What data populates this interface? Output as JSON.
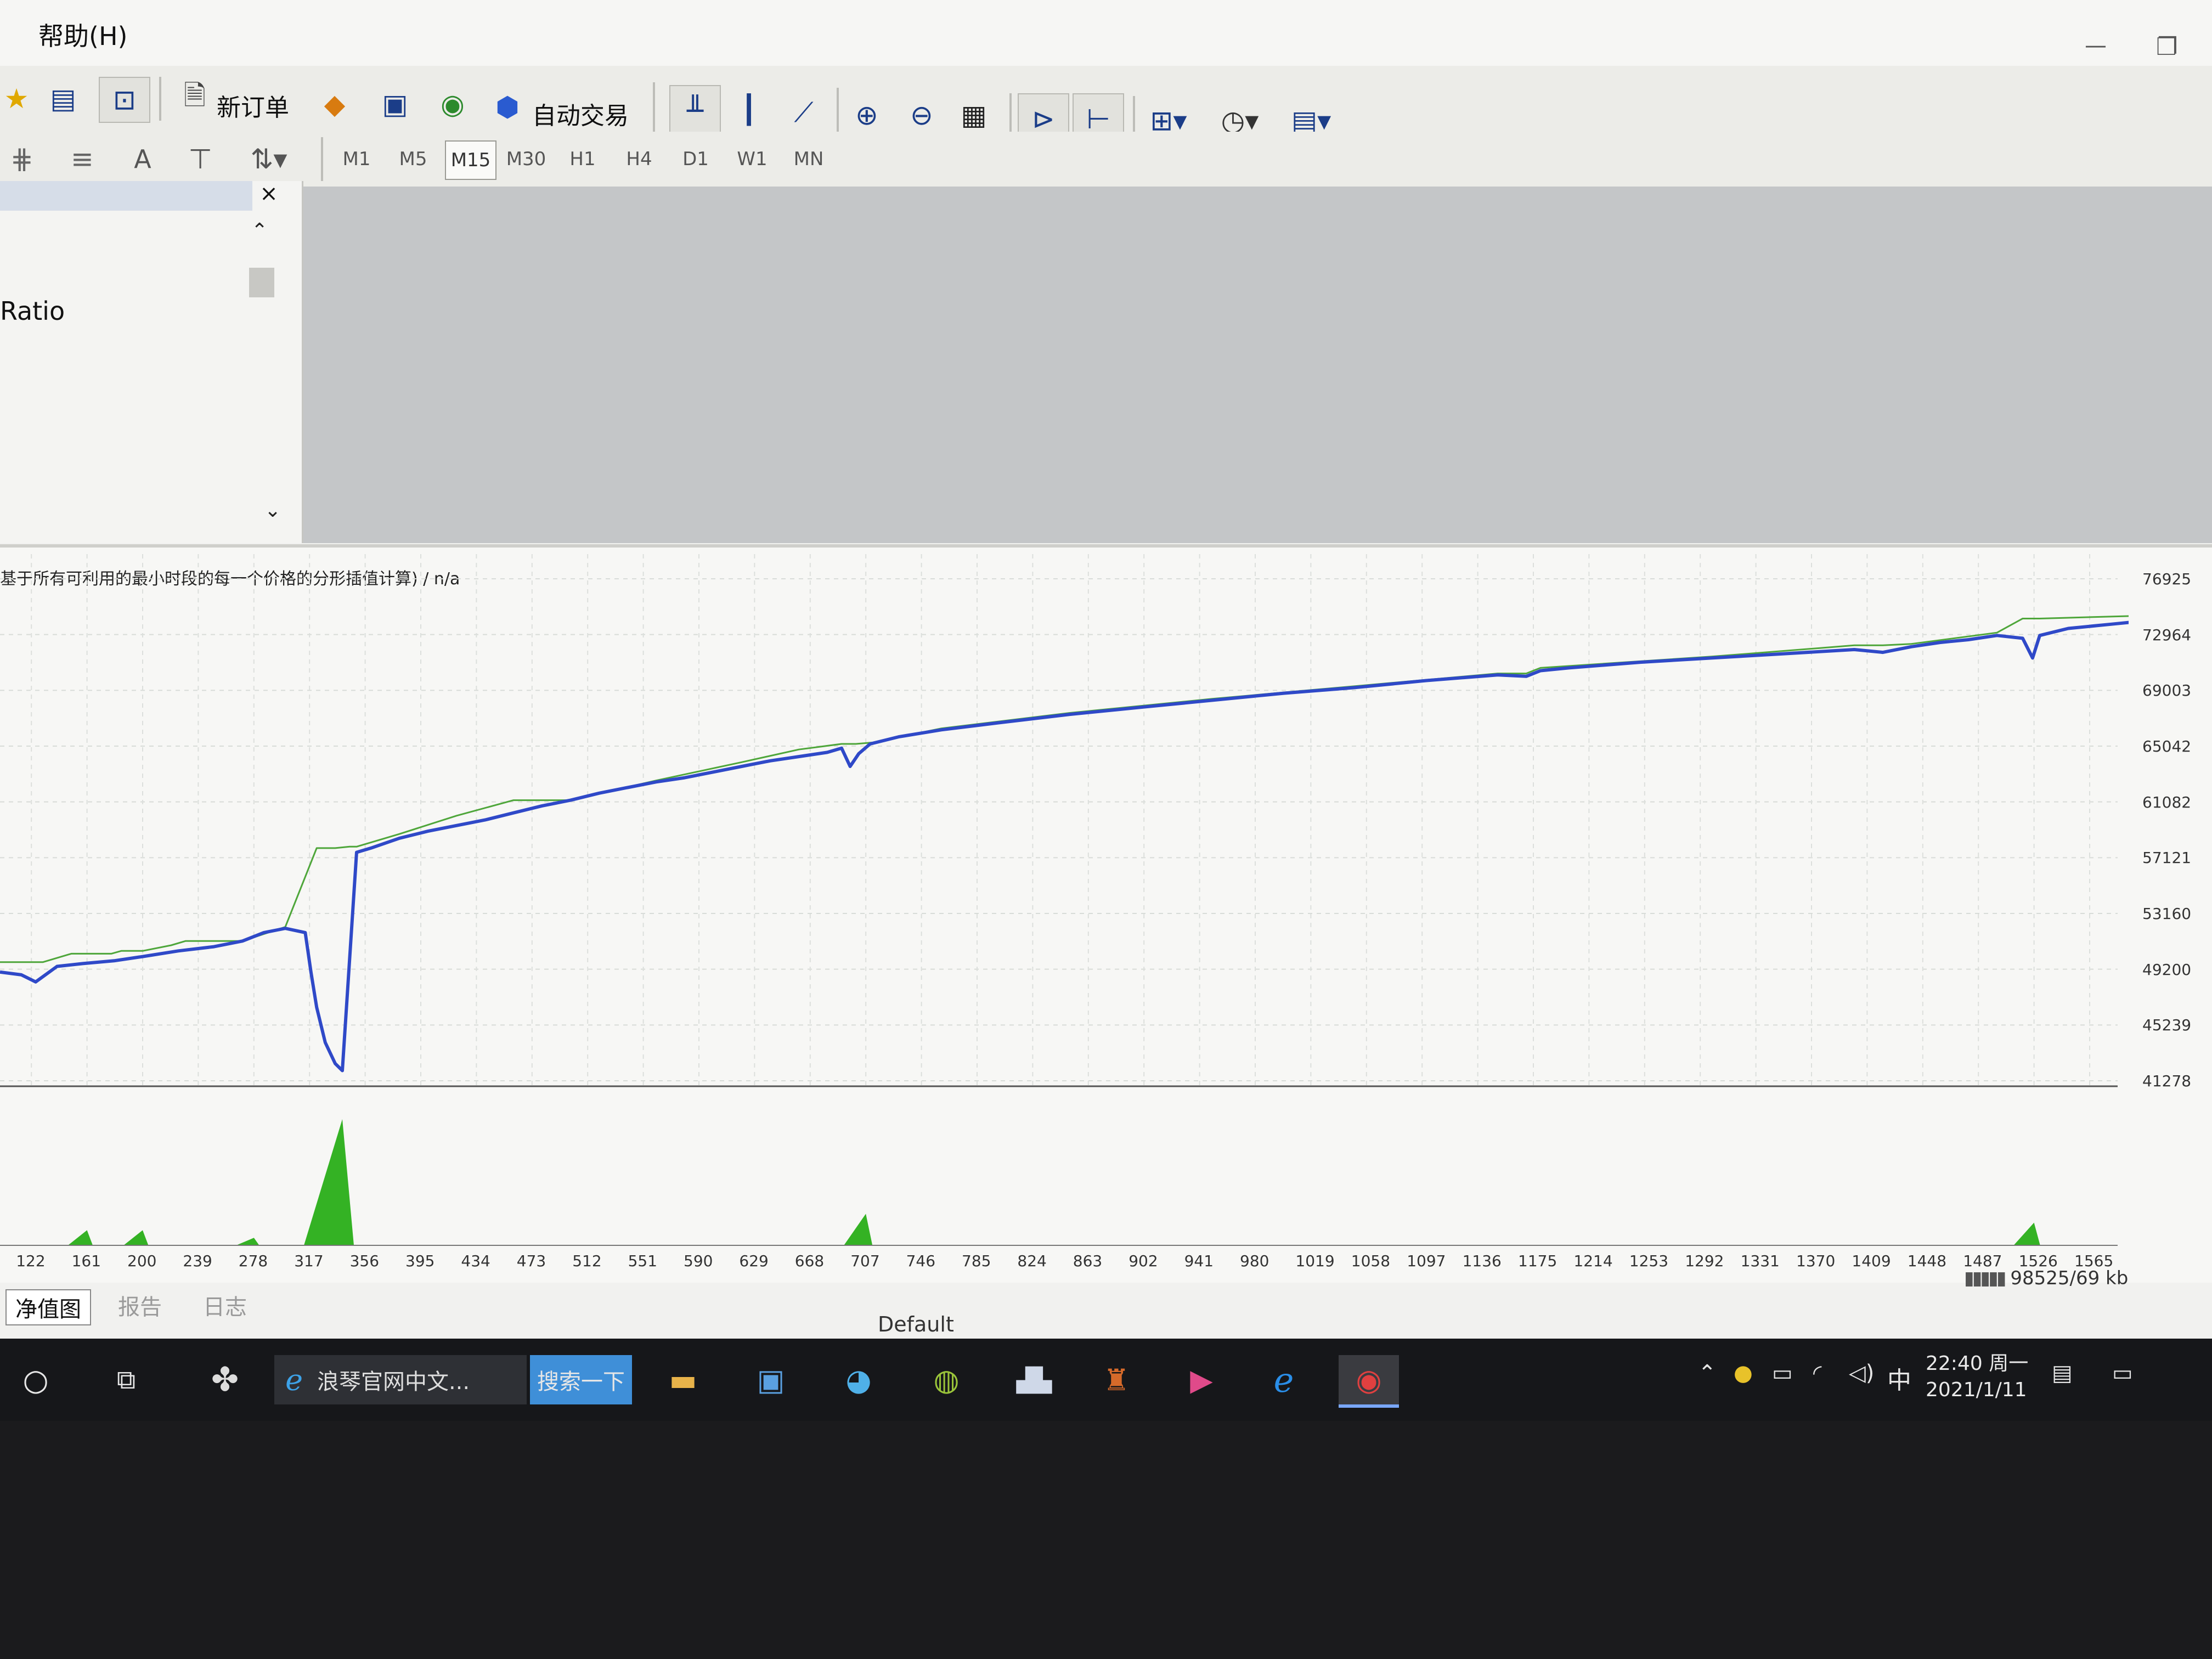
{
  "menu": {
    "help": "帮助(H)"
  },
  "toolbar1": {
    "new_order": "新订单",
    "auto_trading": "自动交易"
  },
  "toolbar2": {
    "text_tool": "A",
    "timeframes": [
      "M1",
      "M5",
      "M15",
      "M30",
      "H1",
      "H4",
      "D1",
      "W1",
      "MN"
    ],
    "active_timeframe": "M15"
  },
  "navigator": {
    "close": "×",
    "visible_text": "Ratio"
  },
  "tester": {
    "graph_title": "基于所有可利用的最小时段的每一个价格的分形插值计算) / n/a",
    "tabs": [
      "净值图",
      "报告",
      "日志"
    ],
    "active_tab": "净值图",
    "profile": "Default",
    "memory": "98525/69 kb"
  },
  "taskbar": {
    "browser_tab": "浪琴官网中文...",
    "search_button": "搜索一下",
    "ime": "中",
    "time": "22:40 周一",
    "date": "2021/1/11"
  },
  "colors": {
    "balance": "#2f49c8",
    "equity": "#4ea63a",
    "volume": "#34b224"
  },
  "chart_data": {
    "type": "line",
    "title": "基于所有可利用的最小时段的每一个价格的分形插值计算) / n/a",
    "xlabel": "",
    "ylabel": "",
    "x_ticks": [
      "122",
      "161",
      "200",
      "239",
      "278",
      "317",
      "356",
      "395",
      "434",
      "473",
      "512",
      "551",
      "590",
      "629",
      "668",
      "707",
      "746",
      "785",
      "824",
      "863",
      "902",
      "941",
      "980",
      "1019",
      "1058",
      "1097",
      "1136",
      "1175",
      "1214",
      "1253",
      "1292",
      "1331",
      "1370",
      "1409",
      "1448",
      "1487",
      "1526",
      "1565"
    ],
    "y_ticks": [
      "76925",
      "72964",
      "69003",
      "65042",
      "61082",
      "57121",
      "53160",
      "49200",
      "45239",
      "41278"
    ],
    "xlim": [
      100,
      1600
    ],
    "ylim": [
      41278,
      76925
    ],
    "grid": true,
    "series": [
      {
        "x": [
          100,
          115,
          125,
          140,
          158,
          180,
          200,
          225,
          250,
          270,
          285,
          300,
          314,
          318,
          322,
          328,
          335,
          340,
          350,
          360,
          380,
          400,
          420,
          440,
          460,
          480,
          500,
          520,
          540,
          560,
          580,
          600,
          620,
          640,
          660,
          680,
          690,
          696,
          702,
          710,
          730,
          760,
          800,
          850,
          900,
          950,
          1000,
          1050,
          1100,
          1150,
          1170,
          1180,
          1200,
          1250,
          1300,
          1350,
          1400,
          1420,
          1440,
          1460,
          1480,
          1500,
          1518,
          1525,
          1530,
          1550,
          1580,
          1600
        ],
        "y": [
          49000,
          48800,
          48300,
          49400,
          49600,
          49800,
          50100,
          50500,
          50800,
          51200,
          51800,
          52100,
          51800,
          49000,
          46500,
          44000,
          42500,
          42000,
          57500,
          57800,
          58500,
          59000,
          59400,
          59800,
          60300,
          60800,
          61200,
          61700,
          62100,
          62500,
          62800,
          63200,
          63600,
          64000,
          64300,
          64600,
          64900,
          63600,
          64500,
          65200,
          65700,
          66200,
          66700,
          67300,
          67800,
          68300,
          68800,
          69200,
          69700,
          70100,
          70000,
          70400,
          70600,
          71000,
          71300,
          71600,
          71900,
          71700,
          72100,
          72400,
          72600,
          72900,
          72700,
          71300,
          72900,
          73400,
          73700,
          73900
        ]
      },
      {
        "x": [
          100,
          125,
          130,
          150,
          160,
          178,
          185,
          200,
          220,
          230,
          250,
          270,
          300,
          322,
          328,
          335,
          345,
          350,
          380,
          420,
          460,
          480,
          500,
          560,
          620,
          660,
          690,
          696,
          700,
          712,
          760,
          850,
          950,
          1050,
          1150,
          1170,
          1180,
          1300,
          1400,
          1420,
          1440,
          1500,
          1518,
          1525,
          1530,
          1600
        ],
        "y": [
          49700,
          49700,
          49700,
          50300,
          50300,
          50300,
          50500,
          50500,
          50900,
          51200,
          51200,
          51200,
          52200,
          57800,
          57800,
          57800,
          57900,
          57900,
          58800,
          60100,
          61200,
          61200,
          61200,
          62600,
          63900,
          64800,
          65200,
          65200,
          65200,
          65300,
          66300,
          67400,
          68400,
          69300,
          70200,
          70200,
          70600,
          71400,
          72200,
          72200,
          72300,
          73100,
          74100,
          74100,
          74100,
          74300
        ]
      }
    ],
    "volume_peaks": [
      {
        "x": 161,
        "value": 0.12
      },
      {
        "x": 200,
        "value": 0.12
      },
      {
        "x": 278,
        "value": 0.06
      },
      {
        "x": 340,
        "value": 1.0
      },
      {
        "x": 707,
        "value": 0.25
      },
      {
        "x": 1526,
        "value": 0.18
      }
    ]
  }
}
